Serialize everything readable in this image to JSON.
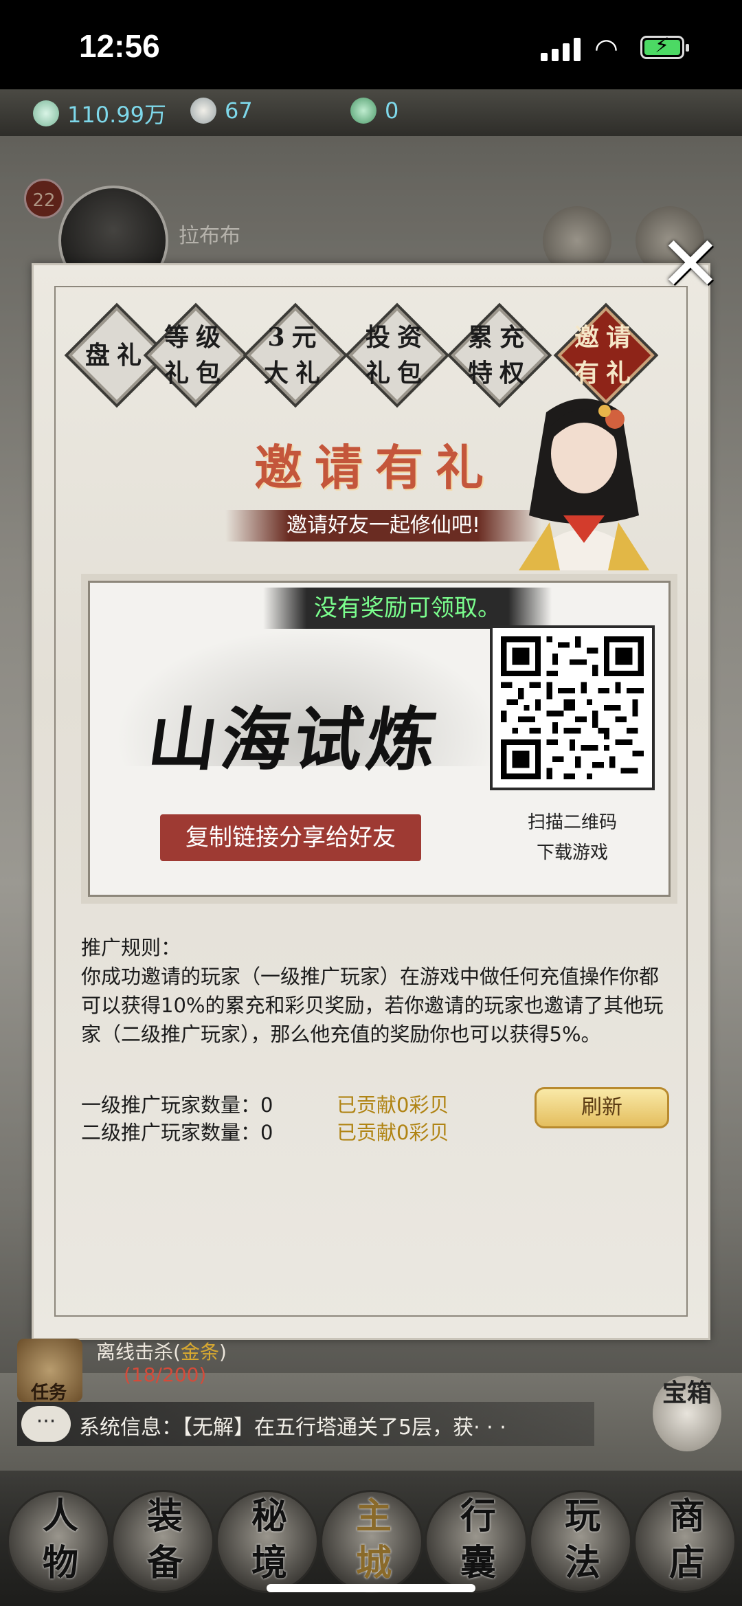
{
  "status_bar": {
    "time": "12:56"
  },
  "resources": {
    "jade": "110.99万",
    "shell": "67",
    "token": "0"
  },
  "player": {
    "level": "22",
    "name": "拉布布"
  },
  "tabs": [
    {
      "label": "盘礼",
      "active": false
    },
    {
      "label": "等级礼包",
      "active": false
    },
    {
      "label": "3元大礼",
      "active": false
    },
    {
      "label": "投资礼包",
      "active": false
    },
    {
      "label": "累充特权",
      "active": false
    },
    {
      "label": "邀请有礼",
      "active": true
    }
  ],
  "banner": {
    "title": "邀请有礼",
    "subtitle": "邀请好友一起修仙吧!"
  },
  "card": {
    "status": "没有奖励可领取。",
    "logo": "山海试炼",
    "share_button": "复制链接分享给好友",
    "qr_caption_1": "扫描二维码",
    "qr_caption_2": "下载游戏"
  },
  "rules": {
    "heading": "推广规则：",
    "body": "你成功邀请的玩家（一级推广玩家）在游戏中做任何充值操作你都可以获得10%的累充和彩贝奖励，若你邀请的玩家也邀请了其他玩家（二级推广玩家），那么他充值的奖励你也可以获得5%。"
  },
  "stats": {
    "level1_label": "一级推广玩家数量：0",
    "level1_contrib": "已贡献0彩贝",
    "level2_label": "二级推广玩家数量：0",
    "level2_contrib": "已贡献0彩贝"
  },
  "refresh_button": "刷新",
  "task": {
    "label": "任务",
    "title": "离线击杀(",
    "title_gold": "金条",
    "title_end": ")",
    "progress": "(18/200)"
  },
  "system_message": "系统信息：【无解】在五行塔通关了5层，获· · ·",
  "treasure_button": "宝箱",
  "nav": [
    {
      "label": "人物",
      "active": false
    },
    {
      "label": "装备",
      "active": false
    },
    {
      "label": "秘境",
      "active": false
    },
    {
      "label": "主城",
      "active": true
    },
    {
      "label": "行囊",
      "active": false
    },
    {
      "label": "玩法",
      "active": false
    },
    {
      "label": "商店",
      "active": false
    }
  ],
  "colors": {
    "accent_red": "#8e2418",
    "gold": "#b08414",
    "green_status": "#7bff8e"
  }
}
